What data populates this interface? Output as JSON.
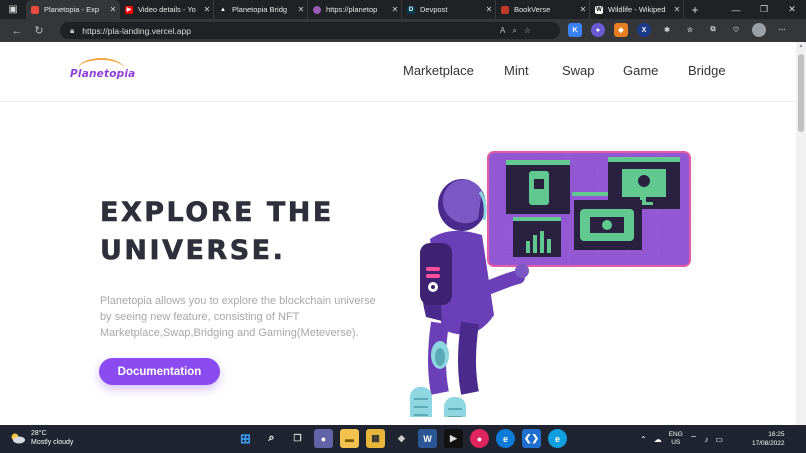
{
  "browser": {
    "tabs": [
      {
        "title": "Planetopia - Exp",
        "favicon": "planetopia-icon",
        "color": "#e74c3c",
        "active": true
      },
      {
        "title": "Video details - Yo",
        "favicon": "youtube-icon",
        "color": "#ff0000",
        "active": false
      },
      {
        "title": "Planetopia Bridg",
        "favicon": "vercel-icon",
        "color": "#ffffff",
        "active": false
      },
      {
        "title": "https://planetop",
        "favicon": "planet-icon",
        "color": "#9b59b6",
        "active": false
      },
      {
        "title": "Devpost",
        "favicon": "devpost-icon",
        "color": "#003e54",
        "active": false
      },
      {
        "title": "BookVerse",
        "favicon": "bookverse-icon",
        "color": "#c0392b",
        "active": false
      },
      {
        "title": "Wildlife - Wikiped",
        "favicon": "wikipedia-icon",
        "color": "#ffffff",
        "active": false
      }
    ],
    "url": "https://pla-landing.vercel.app"
  },
  "site": {
    "logo_text": "Planetopia",
    "nav": [
      "Marketplace",
      "Mint",
      "Swap",
      "Game",
      "Bridge"
    ],
    "hero_title_1": "EXPLORE THE",
    "hero_title_2": "UNIVERSE.",
    "hero_desc": "Planetopia allows you to explore the blockchain universe by seeing new feature, consisting of NFT Marketplace,Swap,Bridging and Gaming(Meteverse).",
    "cta_label": "Documentation",
    "accent": "#8a4cf0"
  },
  "taskbar": {
    "weather_temp": "28°C",
    "weather_desc": "Mostly cloudy",
    "lang_1": "ENG",
    "lang_2": "US",
    "time": "16:25",
    "date": "17/08/2022"
  }
}
